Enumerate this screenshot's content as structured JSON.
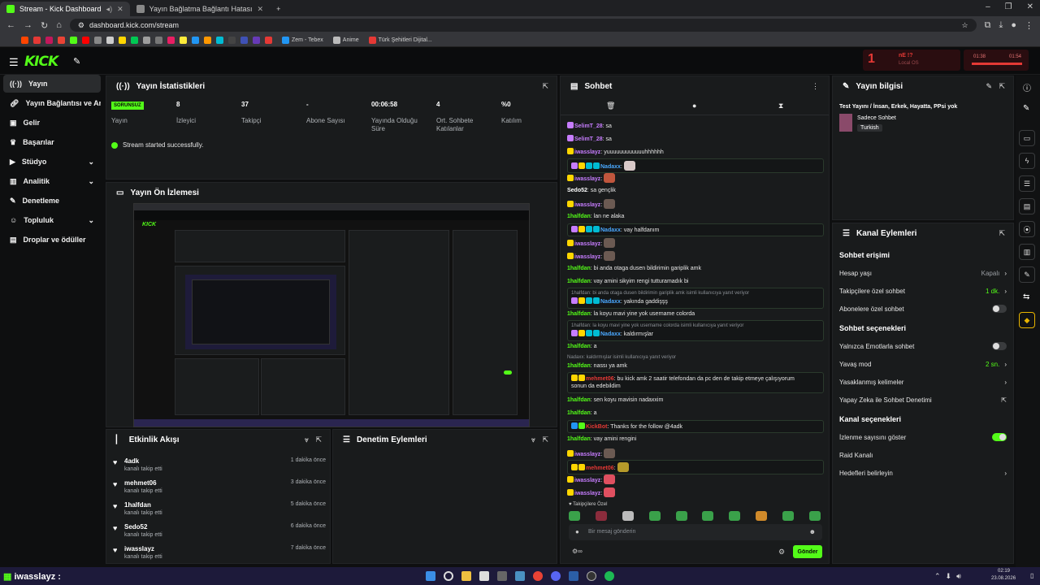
{
  "browser": {
    "tabs": [
      {
        "title": "Stream - Kick Dashboard",
        "active": true
      },
      {
        "title": "Yayın Bağlatma Bağlantı Hatası",
        "active": false
      }
    ],
    "url": "dashboard.kick.com/stream",
    "bookmarks": [
      "Zem - Tebex",
      "Anime",
      "Türk Şehitleri Dijital..."
    ]
  },
  "app": {
    "logo": "KICK",
    "top_alert": {
      "icon_text": "1",
      "title": "nE !?",
      "sub": "Local OS"
    },
    "top_meter": {
      "left": "01:38",
      "right": "01:54"
    }
  },
  "sidebar": {
    "items": [
      {
        "label": "Yayın",
        "icon": "broadcast-icon",
        "active": true
      },
      {
        "label": "Yayın Bağlantısı ve Anahtarı",
        "icon": "link-icon"
      },
      {
        "label": "Gelir",
        "icon": "money-icon"
      },
      {
        "label": "Başarılar",
        "icon": "trophy-icon"
      },
      {
        "label": "Stüdyo",
        "icon": "video-icon",
        "chevron": true
      },
      {
        "label": "Analitik",
        "icon": "chart-icon",
        "chevron": true
      },
      {
        "label": "Denetleme",
        "icon": "wrench-icon"
      },
      {
        "label": "Topluluk",
        "icon": "users-icon",
        "chevron": true
      },
      {
        "label": "Droplar ve ödüller",
        "icon": "gift-icon"
      }
    ]
  },
  "stats": {
    "title": "Yayın İstatistikleri",
    "status_badge": "SORUNSUZ",
    "cells": [
      {
        "value": "",
        "label": "Yayın"
      },
      {
        "value": "8",
        "label": "İzleyici"
      },
      {
        "value": "37",
        "label": "Takipçi"
      },
      {
        "value": "-",
        "label": "Abone Sayısı"
      },
      {
        "value": "00:06:58",
        "label": "Yayında Olduğu Süre"
      },
      {
        "value": "4",
        "label": "Ort. Sohbete Katılanlar"
      },
      {
        "value": "%0",
        "label": "Katılım"
      }
    ],
    "success_message": "Stream started successfully."
  },
  "preview": {
    "title": "Yayın Ön İzlemesi"
  },
  "activity": {
    "title": "Etkinlik Akışı",
    "items": [
      {
        "name": "4adk",
        "sub": "kanalı takip etti",
        "time": "1 dakika önce"
      },
      {
        "name": "mehmet06",
        "sub": "kanalı takip etti",
        "time": "3 dakika önce"
      },
      {
        "name": "1halfdan",
        "sub": "kanalı takip etti",
        "time": "5 dakika önce"
      },
      {
        "name": "Sedo52",
        "sub": "kanalı takip etti",
        "time": "6 dakika önce"
      },
      {
        "name": "iwasslayz",
        "sub": "kanalı takip etti",
        "time": "7 dakika önce"
      }
    ]
  },
  "moderation": {
    "title": "Denetim Eylemleri"
  },
  "chat": {
    "title": "Sohbet",
    "followers_only_label": "Takipçilere Özel",
    "input_placeholder": "Bir mesaj gönderin",
    "send_label": "Gönder",
    "messages": [
      {
        "user": "SelimT_28",
        "text": ": sa",
        "color": "#c77dff"
      },
      {
        "user": "SelimT_28",
        "text": ": sa",
        "color": "#c77dff"
      },
      {
        "user": "iwasslayz",
        "text": ": yuuuuuuuuuuuuhhhhhh",
        "color": "#c77dff"
      },
      {
        "user": "Nadaxx",
        "text": ":",
        "color": "#4aa8ff",
        "hl": true
      },
      {
        "user": "iwasslayz",
        "text": ":",
        "color": "#c77dff"
      },
      {
        "user": "Sedo52",
        "text": ": sa gençlik",
        "color": "#ffffff"
      },
      {
        "user": "iwasslayz",
        "text": ":",
        "color": "#c77dff"
      },
      {
        "user": "1halfdan",
        "text": ": lan ne alaka",
        "color": "#53fc18"
      },
      {
        "user": "Nadaxx",
        "text": ": vay halfdanım",
        "color": "#4aa8ff",
        "hl": true
      },
      {
        "user": "iwasslayz",
        "text": ":",
        "color": "#c77dff"
      },
      {
        "user": "iwasslayz",
        "text": ":",
        "color": "#c77dff"
      },
      {
        "user": "1halfdan",
        "text": ": bi anda otaga dusen bildirimin gariplik amk",
        "color": "#53fc18"
      },
      {
        "user": "1halfdan",
        "text": ": vay amini sikyim rengi tutturamadık bi",
        "color": "#53fc18"
      }
    ],
    "reply1": "1halfdan: bi anda otaga dusen bildirimin gariplik amk isimli kullanıcıya yanıt veriyor",
    "msg_yakinda": {
      "user": "Nadaxx",
      "text": ": yakında gaddişşş"
    },
    "msg_koyu": {
      "user": "1halfdan",
      "text": ": la koyu mavi yine yok username colorda"
    },
    "reply2": "1halfdan: la koyu mavi yine yok username colorda isimli kullanıcıya yanıt veriyor",
    "msg_kaldir": {
      "user": "Nadaxx",
      "text": ": kaldırmışlar"
    },
    "msg_a1": {
      "user": "1halfdan",
      "text": ": a"
    },
    "reply3": "Nadaxx: kaldırmışlar isimli kullanıcıya yanıt veriyor",
    "msg_nasi": {
      "user": "1halfdan",
      "text": ": nassı ya amk"
    },
    "msg_mehmet": {
      "user": "mehmet06",
      "text": ": bu kick amk 2 saatir telefondan da pc den de takip etmeye çalışıyorum"
    },
    "msg_mehmet2": "sonun da edebildim",
    "msg_nadaxxim": {
      "user": "1halfdan",
      "text": ": sen koyu mavisin nadaxxim"
    },
    "msg_a2": {
      "user": "1halfdan",
      "text": ": a"
    },
    "msg_kickbot": {
      "user": "KickBot",
      "text": ": Thanks for the follow @4adk"
    },
    "msg_rengini": {
      "user": "1halfdan",
      "text": ": vay amini rengini"
    },
    "msg_iw1": {
      "user": "iwasslayz",
      "text": ":"
    },
    "msg_mehmet3": {
      "user": "mehmet06",
      "text": ":"
    },
    "msg_iw2": {
      "user": "iwasslayz",
      "text": ":"
    },
    "msg_iw3": {
      "user": "iwasslayz",
      "text": ":"
    }
  },
  "stream_info": {
    "title": "Yayın bilgisi",
    "stream_title": "Test Yayını / İnsan, Erkek, Hayatta, PPsi yok",
    "category": "Sadece Sohbet",
    "language": "Turkish"
  },
  "channel_actions": {
    "title": "Kanal Eylemleri",
    "chat_access": "Sohbet erişimi",
    "account_age": {
      "label": "Hesap yaşı",
      "value": "Kapalı"
    },
    "followers_chat": {
      "label": "Takipçilere özel sohbet",
      "value": "1 dk."
    },
    "subs_chat": {
      "label": "Abonelere özel sohbet"
    },
    "chat_options": "Sohbet seçenekleri",
    "emotes_only": {
      "label": "Yalnızca Emotlarla sohbet"
    },
    "slow_mode": {
      "label": "Yavaş mod",
      "value": "2 sn."
    },
    "banned_words": {
      "label": "Yasaklanmış kelimeler"
    },
    "ai_mod": {
      "label": "Yapay Zeka ile Sohbet Denetimi"
    },
    "channel_options": "Kanal seçenekleri",
    "viewer_count": {
      "label": "İzlenme sayısını göster"
    },
    "raid": {
      "label": "Raid Kanalı"
    },
    "goals": {
      "label": "Hedefleri belirleyin"
    }
  },
  "taskbar": {
    "user": "iwasslayz :",
    "time": "02:19",
    "date": "23.08.2026"
  },
  "colors": {
    "accent": "#53fc18",
    "panel": "#191b1c",
    "bg": "#0e0f10"
  }
}
